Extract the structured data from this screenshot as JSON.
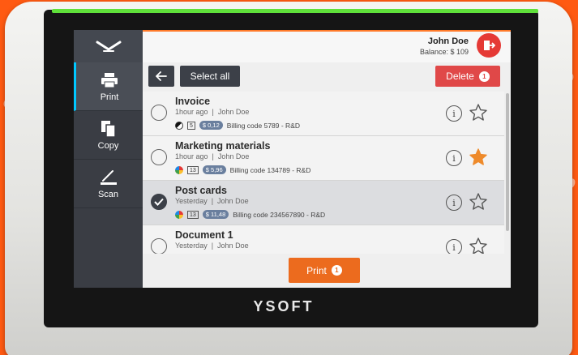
{
  "brand": "YSOFT",
  "sidebar": {
    "items": [
      {
        "label": "Print"
      },
      {
        "label": "Copy"
      },
      {
        "label": "Scan"
      }
    ]
  },
  "user": {
    "name": "John Doe",
    "balance": "Balance: $ 109"
  },
  "toolbar": {
    "select_all_label": "Select all",
    "delete_label": "Delete",
    "delete_count": "1"
  },
  "jobs": [
    {
      "title": "Invoice",
      "time": "1hour ago",
      "owner": "John Doe",
      "mode": "bw",
      "pages": "5",
      "price": "$ 0,12",
      "billing": "Billing code 5789 - R&D",
      "selected": false,
      "favorite": false
    },
    {
      "title": "Marketing materials",
      "time": "1hour ago",
      "owner": "John Doe",
      "mode": "color",
      "pages": "13",
      "price": "$ 5,96",
      "billing": "Billing code 134789 - R&D",
      "selected": false,
      "favorite": true
    },
    {
      "title": "Post cards",
      "time": "Yesterday",
      "owner": "John Doe",
      "mode": "color",
      "pages": "13",
      "price": "$ 11,48",
      "billing": "Billing code 234567890 - R&D",
      "selected": true,
      "favorite": false
    },
    {
      "title": "Document 1",
      "time": "Yesterday",
      "owner": "John Doe",
      "mode": "color",
      "pages": "",
      "price": "",
      "billing": "",
      "selected": false,
      "favorite": false
    }
  ],
  "print_button": {
    "label": "Print",
    "count": "1"
  },
  "colors": {
    "accent": "#ec6b1e",
    "delete": "#e04848",
    "led": "#5fe03a",
    "favorite": "#ee8a2b",
    "sidebar": "#3a3d44"
  }
}
